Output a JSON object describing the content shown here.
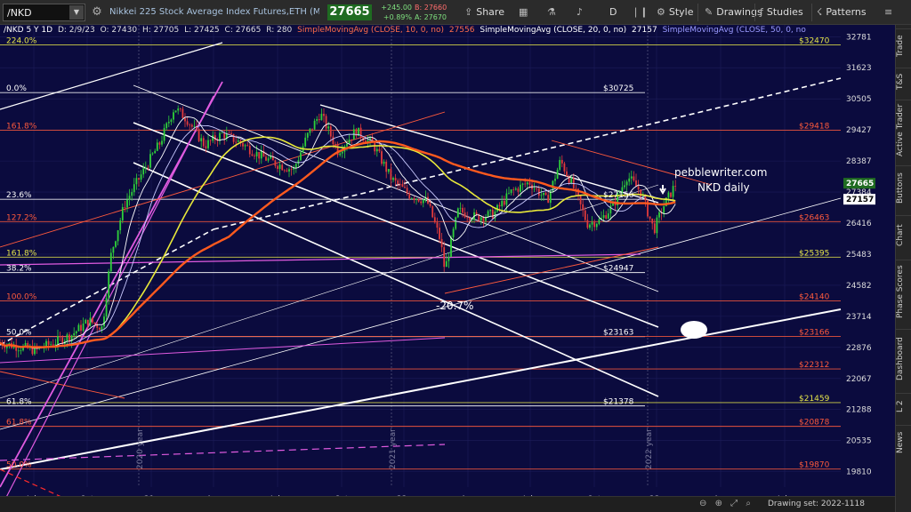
{
  "toolbar": {
    "symbol": "/NKD",
    "description": "Nikkei 225 Stock Average Index Futures,ETH (M...",
    "last_price": "27665",
    "change": "+245.00",
    "change_pct": "+0.89%",
    "bid": "B: 27660",
    "ask": "A: 27670",
    "share_label": "Share",
    "period_label": "D",
    "style_label": "Style",
    "drawings_label": "Drawings",
    "studies_label": "Studies",
    "patterns_label": "Patterns"
  },
  "info_line": {
    "symbol": "/NKD 5 Y 1D",
    "date": "D: 2/9/23",
    "open": "O: 27430",
    "high": "H: 27705",
    "low": "L: 27425",
    "close": "C: 27665",
    "volume": "R: 280",
    "sma10": "SimpleMovingAvg (CLOSE, 10, 0, no)",
    "sma10_val": "27556",
    "sma20": "SimpleMovingAvg (CLOSE, 20, 0, no)",
    "sma20_val": "27157",
    "sma50": "SimpleMovingAvg (CLOSE, 50, 0, no"
  },
  "chart_data": {
    "type": "candlestick",
    "price_axis": [
      "32781",
      "31623",
      "30505",
      "29427",
      "28387",
      "27384",
      "26416",
      "25483",
      "24582",
      "23714",
      "22876",
      "22067",
      "21288",
      "20535",
      "19810"
    ],
    "time_axis": [
      "Jul",
      "Oct",
      "21",
      "Apr",
      "Jul",
      "Oct",
      "22",
      "Apr",
      "Jul",
      "Oct",
      "23",
      "Apr",
      "Jul"
    ],
    "year_labels": [
      "2020 year",
      "2021 year",
      "2022 year"
    ],
    "fib_levels": [
      {
        "pct": "224.0%",
        "price": "$32470",
        "color": "#e4e44a"
      },
      {
        "pct": "0.0%",
        "price": "$30725",
        "color": "#ffffff"
      },
      {
        "pct": "161.8%",
        "price": "$29418",
        "color": "#ff5a3c"
      },
      {
        "pct": "23.6%",
        "price": "$27156",
        "color": "#ffffff"
      },
      {
        "pct": "127.2%",
        "price": "$26463",
        "color": "#ff5a3c"
      },
      {
        "pct": "161.8%",
        "price": "$25395",
        "color": "#e4e44a"
      },
      {
        "pct": "38.2%",
        "price": "$24947",
        "color": "#ffffff"
      },
      {
        "pct": "100.0%",
        "price": "$24140",
        "color": "#ff5a3c"
      },
      {
        "pct": "50.0%",
        "price": "$23163",
        "color": "#ffffff"
      },
      {
        "pct": "",
        "price": "$23166",
        "color": "#ff5a3c"
      },
      {
        "pct": "",
        "price": "$22312",
        "color": "#ff5a3c"
      },
      {
        "pct": "61.8%",
        "price": "$21378",
        "color": "#ffffff"
      },
      {
        "pct": "",
        "price": "$21459",
        "color": "#e4e44a"
      },
      {
        "pct": "61.8%",
        "price": "$20878",
        "color": "#ff5a3c"
      },
      {
        "pct": "50.0%",
        "price": "$19870",
        "color": "#ff5a3c"
      }
    ],
    "annotations": {
      "drawdown": "-20.7%",
      "brand": "pebblewriter.com",
      "subtitle": "NKD daily"
    },
    "price_tags": [
      {
        "text": "27665",
        "color": "#1f6b21"
      },
      {
        "text": "27157",
        "color": "#ffffff"
      }
    ],
    "colors": {
      "background": "#0b0b3e",
      "up": "#2fd13a",
      "down": "#e23b3b",
      "sma10": "#ffffff",
      "sma20": "#e8e83a",
      "sma50": "#ff5a1e",
      "sma200": "#c9c9ff"
    }
  },
  "sidebar": {
    "tabs": [
      "Trade",
      "T&S",
      "Active Trader",
      "Buttons",
      "Chart",
      "Phase Scores",
      "Dashboard",
      "L 2",
      "News"
    ]
  },
  "bottom": {
    "drawing_set": "Drawing set: 2022-1118"
  }
}
